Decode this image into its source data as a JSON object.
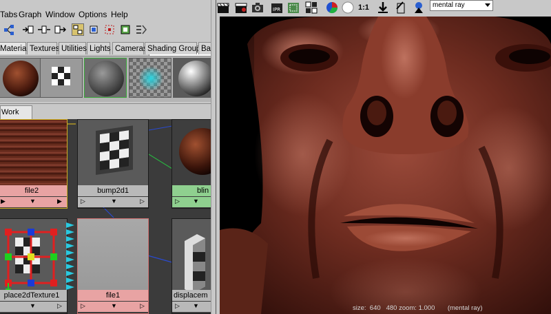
{
  "hypershade": {
    "menus": [
      "Tabs",
      "Graph",
      "Window",
      "Options",
      "Help"
    ],
    "tabs": [
      "Materials",
      "Textures",
      "Utilities",
      "Lights",
      "Cameras",
      "Shading Groups",
      "Ba"
    ],
    "workarea_tab": "Work Area",
    "nodes": {
      "file2": "file2",
      "bump2d1": "bump2d1",
      "blinn": "blin",
      "place2dTexture1": "place2dTexture1",
      "file1": "file1",
      "displacement": "displacem"
    }
  },
  "render_view": {
    "zoom_label": "1:1",
    "renderer": "mental ray",
    "info": "size:  640   480 zoom: 1.000       (mental ray)"
  },
  "icons": {
    "toolbar": [
      "graph-icon",
      "input-connections-icon",
      "input-output-icon",
      "output-connections-icon",
      "graph-mode-icon",
      "selection-icon",
      "clear-icon",
      "rearrange-icon"
    ],
    "render_toolbar": [
      "clapboard-icon",
      "clapboard-redo-icon",
      "snapshot-icon",
      "ipr-icon",
      "region-icon",
      "options-icon",
      "rgb-icon",
      "alpha-icon",
      "keep-image-icon",
      "remove-image-icon",
      "rv-extra-icon"
    ]
  }
}
